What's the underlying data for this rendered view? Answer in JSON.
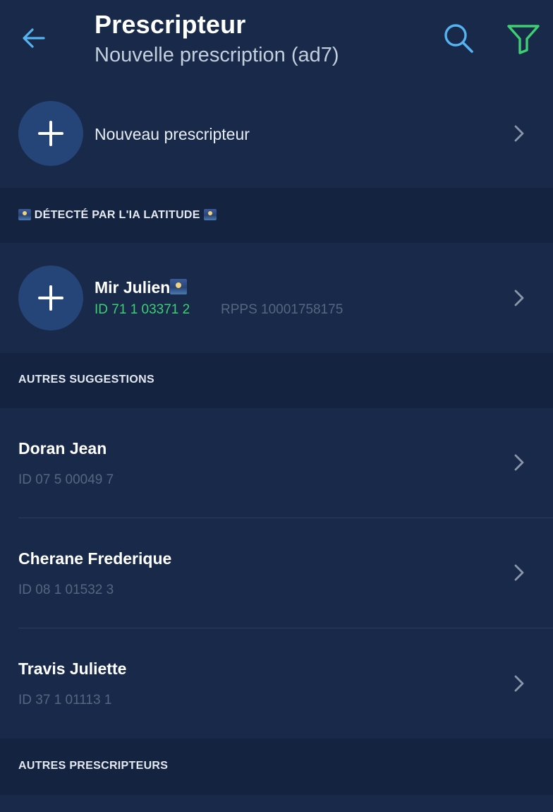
{
  "header": {
    "title": "Prescripteur",
    "subtitle": "Nouvelle prescription (ad7)",
    "back_icon": "arrow-left-icon",
    "search_icon": "search-icon",
    "filter_icon": "filter-icon"
  },
  "new_prescriber": {
    "label": "Nouveau prescripteur"
  },
  "ai_section": {
    "title": "DÉTECTÉ PAR L'IA LATITUDE",
    "item": {
      "name": "Mir Julien",
      "id": "ID 71 1 03371 2",
      "rpps": "RPPS 10001758175"
    }
  },
  "suggestions_section": {
    "title": "AUTRES SUGGESTIONS",
    "items": [
      {
        "name": "Doran Jean",
        "id": "ID 07 5 00049 7"
      },
      {
        "name": "Cherane Frederique",
        "id": "ID 08 1 01532 3"
      },
      {
        "name": "Travis Juliette",
        "id": "ID 37 1 01113 1"
      }
    ]
  },
  "others_section": {
    "title": "AUTRES PRESCRIPTEURS"
  },
  "colors": {
    "background": "#19294a",
    "section_background": "#142340",
    "accent_blue": "#55b4f0",
    "accent_green": "#3ecf72",
    "plus_circle": "#254477",
    "muted_text": "#56667e"
  }
}
